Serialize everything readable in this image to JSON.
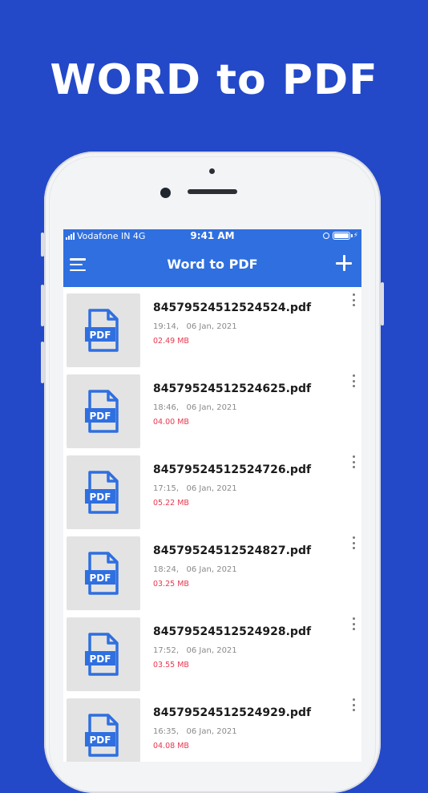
{
  "promo": {
    "title": "WORD to PDF"
  },
  "statusbar": {
    "carrier": "Vodafone IN 4G",
    "time": "9:41 AM"
  },
  "appbar": {
    "title": "Word to PDF"
  },
  "file_icon_label": "PDF",
  "colors": {
    "background": "#2349c8",
    "appbar": "#2f6fe0",
    "size_text": "#e8374f",
    "icon_blue": "#2f6fe0"
  },
  "files": [
    {
      "name": "84579524512524524.pdf",
      "date": "19:14,   06 Jan, 2021",
      "size": "02.49 MB"
    },
    {
      "name": "84579524512524625.pdf",
      "date": "18:46,   06 Jan, 2021",
      "size": "04.00 MB"
    },
    {
      "name": "84579524512524726.pdf",
      "date": "17:15,   06 Jan, 2021",
      "size": "05.22 MB"
    },
    {
      "name": "84579524512524827.pdf",
      "date": "18:24,   06 Jan, 2021",
      "size": "03.25 MB"
    },
    {
      "name": "84579524512524928.pdf",
      "date": "17:52,   06 Jan, 2021",
      "size": "03.55 MB"
    },
    {
      "name": "84579524512524929.pdf",
      "date": "16:35,   06 Jan, 2021",
      "size": "04.08 MB"
    }
  ]
}
